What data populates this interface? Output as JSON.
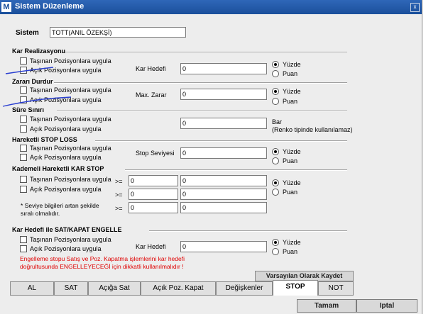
{
  "window": {
    "app_icon": "M",
    "title": "Sistem Düzenleme",
    "close": "x"
  },
  "sistem": {
    "label": "Sistem",
    "value": "TOTT(ANIL ÖZEKŞİ)"
  },
  "common": {
    "tasinan": "Taşınan Pozisyonlara uygula",
    "acik": "Açık Pozisyonlara uygula",
    "yuzde": "Yüzde",
    "puan": "Puan"
  },
  "kar_realizasyonu": {
    "title": "Kar Realizasyonu",
    "field_label": "Kar Hedefi",
    "value": "0",
    "selected": "Yüzde"
  },
  "zarari_durdur": {
    "title": "Zararı Durdur",
    "field_label": "Max. Zarar",
    "value": "0",
    "selected": "Yüzde"
  },
  "sure_siniri": {
    "title": "Süre Sınırı",
    "value": "0",
    "unit": "Bar",
    "note": "(Renko tipinde kullanılamaz)"
  },
  "hareketli_stop": {
    "title": "Hareketli STOP LOSS",
    "field_label": "Stop Seviyesi",
    "value": "0",
    "selected": "Yüzde"
  },
  "kademeli": {
    "title": "Kademeli Hareketli KAR STOP",
    "op": ">=",
    "rows": [
      [
        "0",
        "0"
      ],
      [
        "0",
        "0"
      ],
      [
        "0",
        "0"
      ]
    ],
    "note_line1": "* Seviye bilgileri artan şekilde",
    "note_line2": "sıralı olmalıdır.",
    "selected": "Yüzde"
  },
  "engelle": {
    "title": "Kar Hedefi ile SAT/KAPAT ENGELLE",
    "field_label": "Kar Hedefi",
    "value": "0",
    "selected": "Yüzde",
    "warning": "Engelleme stopu Satış ve Poz. Kapatma işlemlerini kar hedefi doğrultusunda ENGELLEYECEĞİ için dikkatli kullanılmalıdır !"
  },
  "default_button": "Varsayılan Olarak Kaydet",
  "tabs": [
    "AL",
    "SAT",
    "Açığa Sat",
    "Açık Poz. Kapat",
    "Değişkenler",
    "STOP",
    "NOT"
  ],
  "active_tab": "STOP",
  "buttons": {
    "ok": "Tamam",
    "cancel": "Iptal"
  },
  "colors": {
    "title_bar": "#1f57a8",
    "warning": "#e00000",
    "annotation_ink": "#2a3fd0"
  }
}
